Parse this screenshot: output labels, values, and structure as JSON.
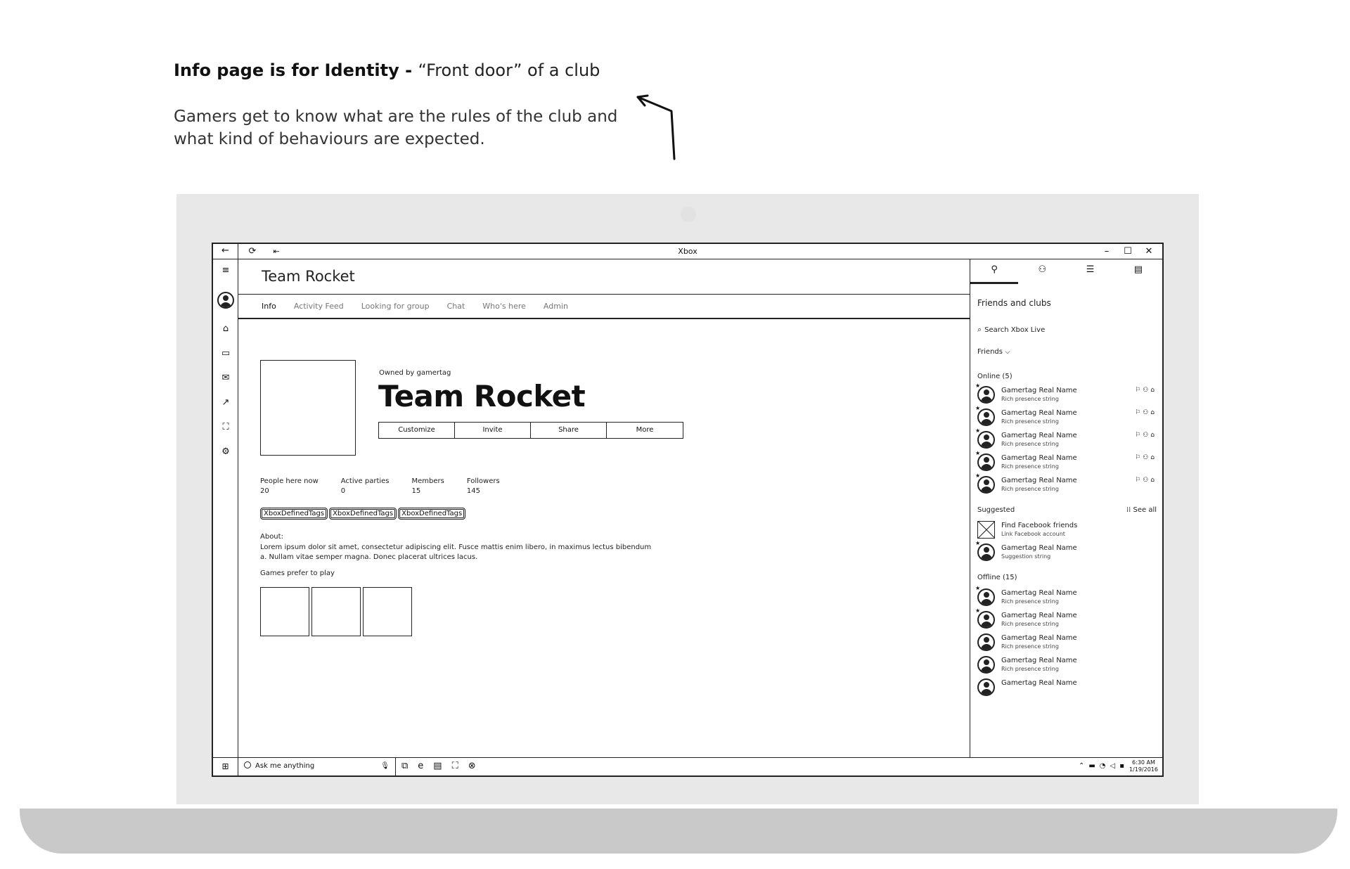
{
  "annotation": {
    "title_bold": "Info page is for Identity - ",
    "title_rest": "“Front door” of a club",
    "body": "Gamers get to know what are the rules of the club and what kind of behaviours are expected."
  },
  "window": {
    "title": "Xbox",
    "back_icon": "←",
    "refresh_icon": "⟳",
    "pin_icon": "⇤",
    "controls": [
      "–",
      "☐",
      "✕"
    ]
  },
  "leftnav": {
    "icons": [
      {
        "name": "hamburger-icon",
        "glyph": "≡"
      },
      {
        "name": "home-icon",
        "glyph": "⌂"
      },
      {
        "name": "my-games-icon",
        "glyph": "▭"
      },
      {
        "name": "messages-icon",
        "glyph": "✉"
      },
      {
        "name": "trending-icon",
        "glyph": "↗"
      },
      {
        "name": "store-icon",
        "glyph": "⛶"
      },
      {
        "name": "settings-icon",
        "glyph": "⚙"
      }
    ]
  },
  "page": {
    "title": "Team Rocket",
    "tabs": [
      "Info",
      "Activity Feed",
      "Looking for group",
      "Chat",
      "Who's here",
      "Admin"
    ],
    "owned_by": "Owned by gamertag",
    "club_name": "Team Rocket",
    "actions": [
      "Customize",
      "Invite",
      "Share",
      "More"
    ],
    "stats": [
      {
        "label": "People here now",
        "value": "20"
      },
      {
        "label": "Active parties",
        "value": "0"
      },
      {
        "label": "Members",
        "value": "15"
      },
      {
        "label": "Followers",
        "value": "145"
      }
    ],
    "tags": [
      "XboxDefinedTags",
      "XboxDefinedTags",
      "XboxDefinedTags"
    ],
    "about_label": "About:",
    "about_text": "Lorem ipsum dolor sit amet, consectetur adipiscing elit. Fusce mattis enim libero, in maximus lectus bibendum a. Nullam vitae semper magna. Donec placerat ultrices lacus.",
    "games_label": "Games prefer to play"
  },
  "rpanel": {
    "heading": "Friends and clubs",
    "search": "Search Xbox Live",
    "filter": "Friends",
    "online_label": "Online (5)",
    "suggested_label": "Suggested",
    "see_all": "See all",
    "offline_label": "Offline (15)",
    "online": [
      {
        "name": "Gamertag Real Name",
        "sub": "Rich presence string"
      },
      {
        "name": "Gamertag Real Name",
        "sub": "Rich presence string"
      },
      {
        "name": "Gamertag Real Name",
        "sub": "Rich presence string"
      },
      {
        "name": "Gamertag Real Name",
        "sub": "Rich presence string"
      },
      {
        "name": "Gamertag Real Name",
        "sub": "Rich presence string"
      }
    ],
    "suggested": [
      {
        "name": "Find Facebook friends",
        "sub": "Link Facebook account"
      },
      {
        "name": "Gamertag Real Name",
        "sub": "Suggestion string"
      }
    ],
    "offline": [
      {
        "name": "Gamertag Real Name",
        "sub": "Rich presence string"
      },
      {
        "name": "Gamertag Real Name",
        "sub": "Rich presence string"
      },
      {
        "name": "Gamertag Real Name",
        "sub": "Rich presence string"
      },
      {
        "name": "Gamertag Real Name",
        "sub": "Rich presence string"
      },
      {
        "name": "Gamertag Real Name",
        "sub": ""
      }
    ]
  },
  "taskbar": {
    "search": "Ask me anything",
    "time": "6:30 AM",
    "date": "1/19/2016"
  }
}
